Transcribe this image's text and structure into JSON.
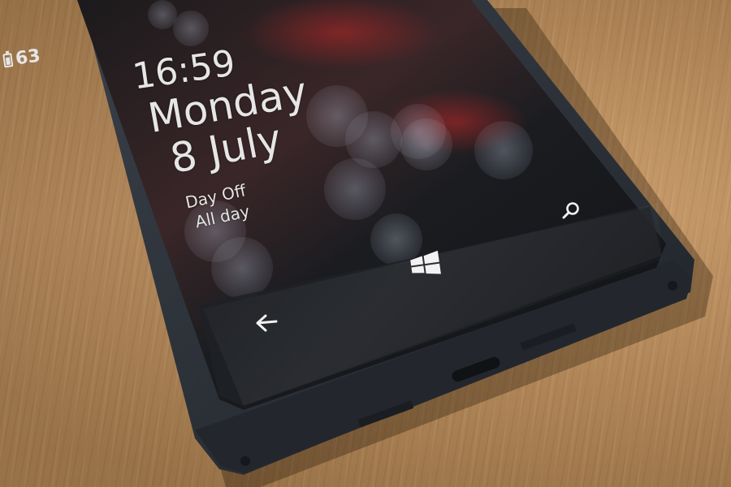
{
  "lock_screen": {
    "time": "16:59",
    "day": "Monday",
    "date": "8 July",
    "event": {
      "title": "Day Off",
      "time": "All day"
    },
    "battery_level": "63"
  },
  "navigation": {
    "back_icon": "back-arrow-icon",
    "start_icon": "windows-start-icon",
    "search_icon": "search-icon"
  },
  "colors": {
    "table_wood": "#b98b55",
    "phone_body": "#2c3138",
    "screen": "#0d0f12",
    "text": "#e6e6e6"
  }
}
